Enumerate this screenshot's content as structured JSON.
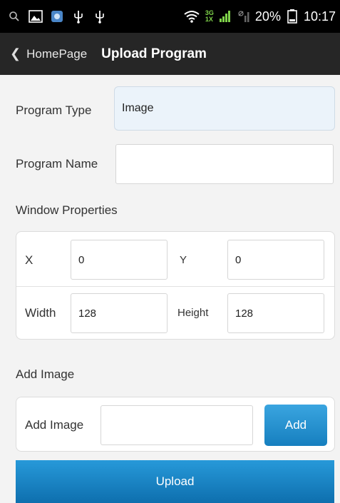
{
  "status_bar": {
    "icons": [
      "search-icon",
      "image-icon",
      "app-icon",
      "usb-icon",
      "usb-icon",
      "wifi-icon",
      "signal-icon"
    ],
    "network_top": "3G",
    "network_bottom": "1X",
    "battery": "20%",
    "time": "10:17"
  },
  "header": {
    "back_label": "HomePage",
    "title": "Upload Program"
  },
  "form": {
    "program_type_label": "Program Type",
    "program_type_value": "Image",
    "program_name_label": "Program Name",
    "program_name_value": "",
    "window_properties_label": "Window Properties",
    "x_label": "X",
    "x_value": "0",
    "y_label": "Y",
    "y_value": "0",
    "width_label": "Width",
    "width_value": "128",
    "height_label": "Height",
    "height_value": "128",
    "add_image_section": "Add Image",
    "add_image_label": "Add Image",
    "add_image_value": "",
    "add_button": "Add",
    "upload_button": "Upload"
  },
  "colors": {
    "status_bar": "#000000",
    "title_bar": "#262626",
    "accent": "#1a88c9",
    "background": "#f3f3f3"
  }
}
